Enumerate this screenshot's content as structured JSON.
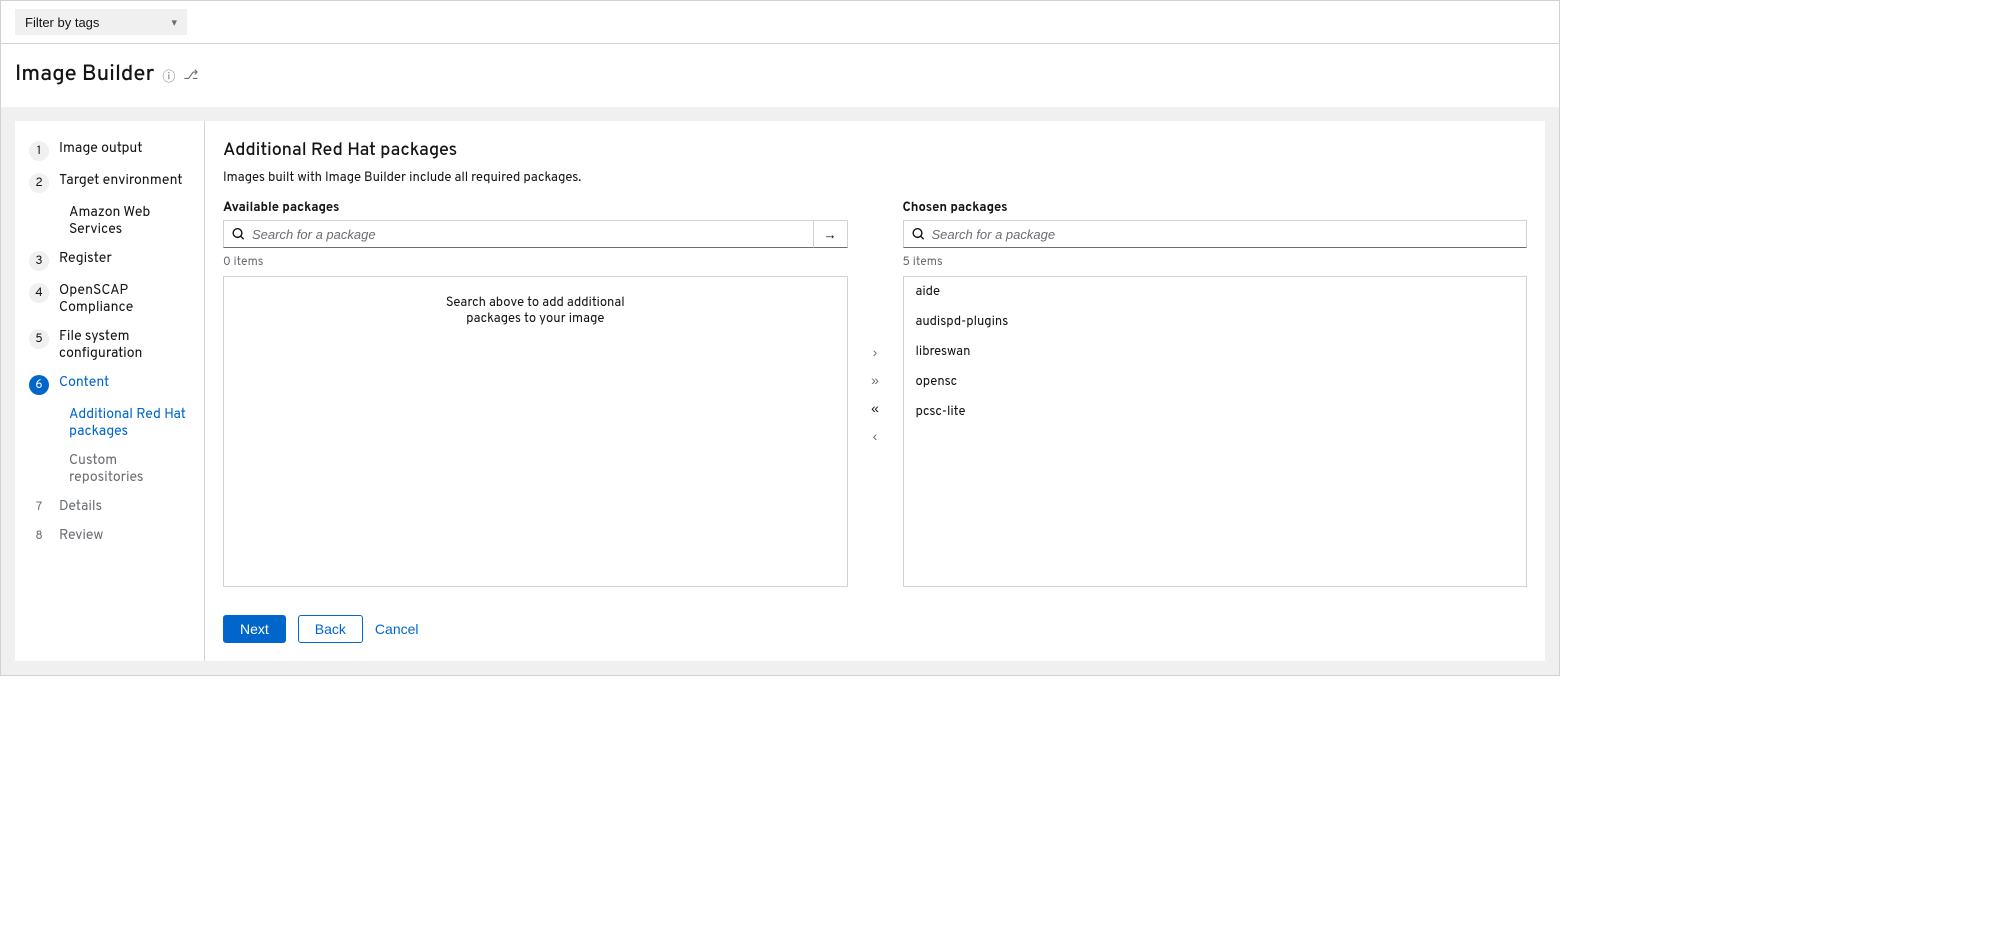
{
  "filter": {
    "label": "Filter by tags"
  },
  "page": {
    "title": "Image Builder"
  },
  "wizard": {
    "steps": [
      {
        "num": "1",
        "label": "Image output"
      },
      {
        "num": "2",
        "label": "Target environment"
      },
      {
        "num": "",
        "label": "Amazon Web Services"
      },
      {
        "num": "3",
        "label": "Register"
      },
      {
        "num": "4",
        "label": "OpenSCAP Compliance"
      },
      {
        "num": "5",
        "label": "File system configuration"
      },
      {
        "num": "6",
        "label": "Content"
      },
      {
        "num": "",
        "label": "Additional Red Hat packages"
      },
      {
        "num": "",
        "label": "Custom repositories"
      },
      {
        "num": "7",
        "label": "Details"
      },
      {
        "num": "8",
        "label": "Review"
      }
    ]
  },
  "main": {
    "heading": "Additional Red Hat packages",
    "description": "Images built with Image Builder include all required packages."
  },
  "available": {
    "title": "Available packages",
    "placeholder": "Search for a package",
    "count": "0 items",
    "empty1": "Search above to add additional",
    "empty2": "packages to your image"
  },
  "chosen": {
    "title": "Chosen packages",
    "placeholder": "Search for a package",
    "count": "5 items",
    "items": [
      "aide",
      "audispd-plugins",
      "libreswan",
      "opensc",
      "pcsc-lite"
    ]
  },
  "buttons": {
    "next": "Next",
    "back": "Back",
    "cancel": "Cancel"
  }
}
